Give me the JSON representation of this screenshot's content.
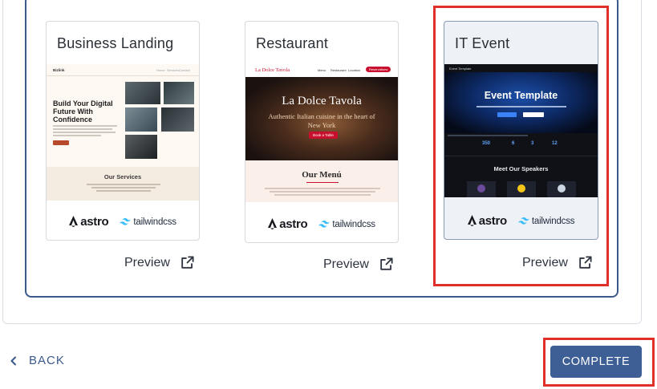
{
  "templates": [
    {
      "id": "business-landing",
      "title": "Business Landing",
      "preview_label": "Preview",
      "selected": false,
      "thumbnail": {
        "brand": "Bizlink",
        "nav": [
          "Home",
          "Services",
          "Contact"
        ],
        "headline": "Build Your Digital Future With Confidence",
        "button": "Get Started",
        "section": "Our Services"
      }
    },
    {
      "id": "restaurant",
      "title": "Restaurant",
      "preview_label": "Preview",
      "selected": false,
      "thumbnail": {
        "brand": "La Dolce Tavola",
        "nav": [
          "Menu",
          "Restaurant",
          "Location"
        ],
        "nav_button": "Reservations",
        "headline": "La Dolce Tavola",
        "subtitle": "Authentic Italian cuisine in the heart of New York",
        "button": "Book a Table",
        "section": "Our Menú"
      }
    },
    {
      "id": "it-event",
      "title": "IT Event",
      "preview_label": "Preview",
      "selected": true,
      "thumbnail": {
        "brand": "Event Template",
        "headline": "Event Template",
        "stats": [
          "350",
          "6",
          "3",
          "12"
        ],
        "section": "Meet Our Speakers"
      }
    }
  ],
  "logos": {
    "astro": "astro",
    "tailwind": "tailwindcss"
  },
  "footer": {
    "back_label": "BACK",
    "complete_label": "COMPLETE"
  },
  "colors": {
    "primary": "#3e5f96",
    "selection_border": "#3b5a8c",
    "highlight": "#e0302a",
    "restaurant_accent": "#c8102e"
  }
}
